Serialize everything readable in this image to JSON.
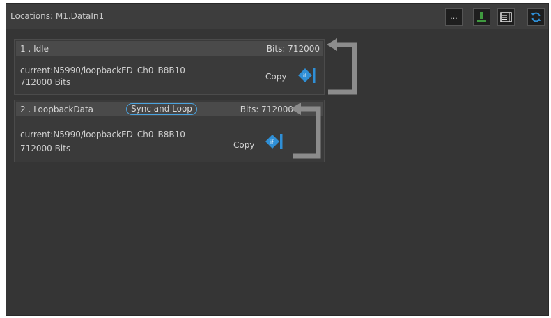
{
  "header": {
    "title": "Locations: M1.DataIn1",
    "more_label": "...",
    "icons": [
      "upload-icon",
      "list-panel-icon",
      "refresh-icon"
    ]
  },
  "segments": [
    {
      "name": "1 . Idle",
      "bits_label": "Bits: 712000",
      "path": "current:N5990/loopbackED_Ch0_B8B10",
      "count": "712000 Bits",
      "copy_label": "Copy"
    },
    {
      "name": "2 . LoopbackData",
      "badge": "Sync and Loop",
      "bits_label": "Bits: 712000",
      "path": "current:N5990/loopbackED_Ch0_B8B10",
      "count": "712000 Bits",
      "copy_label": "Copy"
    }
  ],
  "colors": {
    "background": "#353535",
    "accent_blue": "#2f8fd6",
    "upload_green": "#3f9a3f",
    "loop_arrow": "#8c8c8c"
  }
}
